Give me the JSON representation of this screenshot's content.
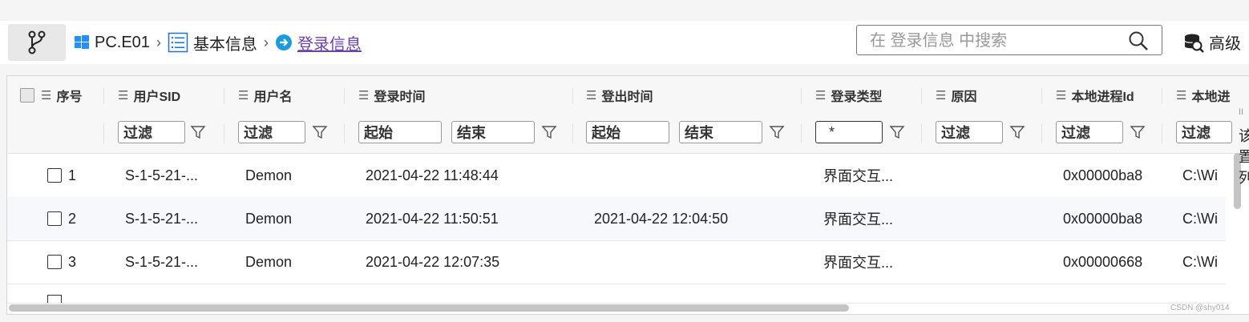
{
  "toolbar": {
    "breadcrumb": [
      {
        "label": "PC.E01",
        "icon": "windows-icon"
      },
      {
        "label": "基本信息",
        "icon": "list-icon"
      },
      {
        "label": "登录信息",
        "icon": "arrow-circle-icon"
      }
    ],
    "search_placeholder": "在 登录信息 中搜索",
    "advanced_label": "高级"
  },
  "grid": {
    "columns": [
      "序号",
      "用户SID",
      "用户名",
      "登录时间",
      "登出时间",
      "登录类型",
      "原因",
      "本地进程Id",
      "本地进"
    ],
    "filters": {
      "filter_placeholder": "过滤",
      "range_start": "起始",
      "range_end": "结束",
      "type_value": "*"
    },
    "rows": [
      {
        "index": "1",
        "sid": "S-1-5-21-...",
        "user": "Demon",
        "login": "2021-04-22 11:48:44",
        "logout": "",
        "type": "界面交互...",
        "reason": "",
        "pid": "0x00000ba8",
        "path": "C:\\Wi"
      },
      {
        "index": "2",
        "sid": "S-1-5-21-...",
        "user": "Demon",
        "login": "2021-04-22 11:50:51",
        "logout": "2021-04-22 12:04:50",
        "type": "界面交互...",
        "reason": "",
        "pid": "0x00000ba8",
        "path": "C:\\Wi"
      },
      {
        "index": "3",
        "sid": "S-1-5-21-...",
        "user": "Demon",
        "login": "2021-04-22 12:07:35",
        "logout": "",
        "type": "界面交互...",
        "reason": "",
        "pid": "0x00000668",
        "path": "C:\\Wi"
      }
    ],
    "side_text": [
      "II",
      "该",
      "置",
      "列"
    ]
  },
  "watermark": "CSDN @shy014",
  "colors": {
    "link": "#6a3fb5",
    "windows": "#1e90ff",
    "accent": "#1a73d8"
  }
}
